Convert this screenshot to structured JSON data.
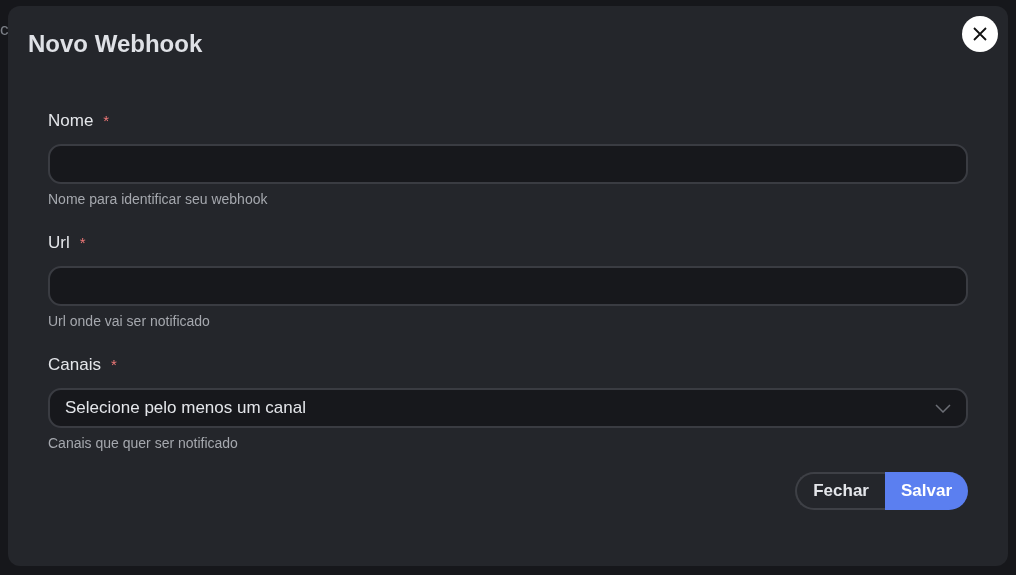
{
  "background_fragments": [
    "c"
  ],
  "dialog": {
    "title": "Novo Webhook",
    "fields": [
      {
        "kind": "text",
        "label": "Nome",
        "required": true,
        "help": "Nome para identificar seu webhook"
      },
      {
        "kind": "text",
        "label": "Url",
        "required": true,
        "help": "Url onde vai ser notificado"
      },
      {
        "kind": "select",
        "label": "Canais",
        "required": true,
        "placeholder": "Selecione pelo menos um canal",
        "help": "Canais que quer ser notificado"
      }
    ],
    "required_mark": "*",
    "buttons": [
      {
        "kind": "secondary",
        "label": "Fechar"
      },
      {
        "kind": "primary",
        "label": "Salvar"
      }
    ]
  }
}
